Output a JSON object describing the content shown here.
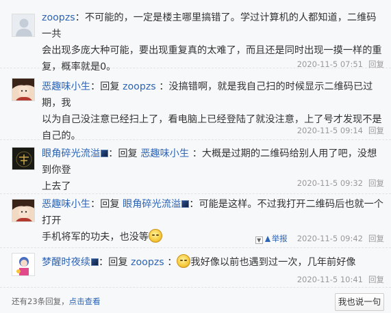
{
  "replies": [
    {
      "user": "zoopzs",
      "text_lines": [
        "：不可能的，一定是楼主哪里搞错了。学过计算机的人都知道，二维码一共",
        "会出现多庞大种可能，要出现重复真的太难了，而且还是同时出现一摸一样的重",
        "复，概率就是0。"
      ],
      "time": "2020-11-5 07:51",
      "reply_label": "回复",
      "avatar": "default-avatar-icon"
    },
    {
      "user": "恶趣味小生",
      "reply_word": "：回复",
      "target": "zoopzs",
      "text_lines": [
        "：没搞错啊，就是我自己扫的时候显示二维码已过期，我",
        "以为自己没注意已经扫上了，看电脑上已经登陆了就没注意，上了号才发现不是",
        "自己的。"
      ],
      "time": "2020-11-5 09:14",
      "reply_label": "回复",
      "avatar": "anime-avatar-icon"
    },
    {
      "user": "眼角碎光流溢",
      "reply_word": "：回复",
      "target": "恶趣味小生",
      "text_lines": [
        "：大概是过期的二维码给别人用了吧，没想到你登",
        "上去了"
      ],
      "time": "2020-11-5 09:32",
      "reply_label": "回复",
      "avatar": "dark-avatar-icon"
    },
    {
      "user": "恶趣味小生",
      "reply_word": "：回复",
      "target": "眼角碎光流溢",
      "text_lines": [
        "：可能是这样。不过我打开二维码后也就一个打开",
        "手机将军的功夫，也没等"
      ],
      "time": "2020-11-5 09:42",
      "reply_label": "回复",
      "report_label": "举报",
      "avatar": "anime-avatar-icon"
    },
    {
      "user": "梦醒时夜续",
      "reply_word": "：回复",
      "target": "zoopzs",
      "text_lines": [
        "：",
        "我好像以前也遇到过一次，几年前好像"
      ],
      "time": "2020-11-5 10:41",
      "reply_label": "回复",
      "avatar": "cartoon-avatar-icon"
    }
  ],
  "footer": {
    "more_prefix": "还有23条回复，",
    "more_link": "点击查看",
    "say_button": "我也说一句"
  },
  "colors": {
    "link": "#2d64b3",
    "meta": "#999999",
    "background": "#f7f8fa"
  }
}
